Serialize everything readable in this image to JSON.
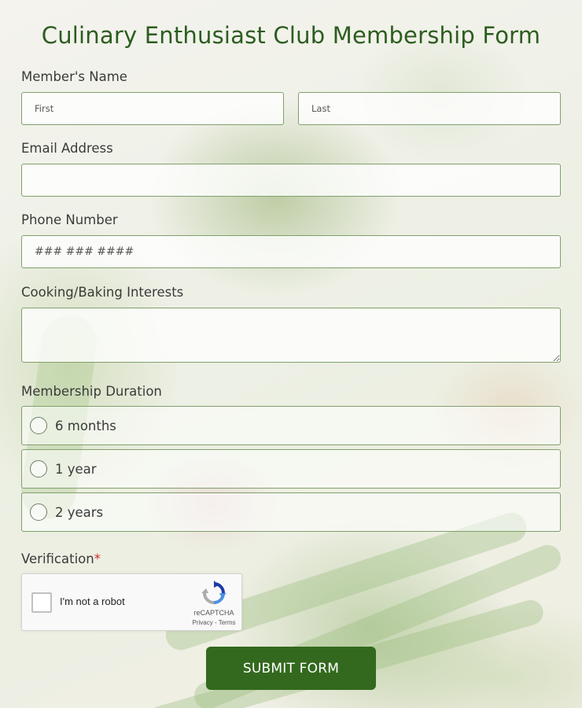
{
  "title": "Culinary Enthusiast Club Membership Form",
  "name": {
    "label": "Member's Name",
    "first_placeholder": "First",
    "last_placeholder": "Last"
  },
  "email": {
    "label": "Email Address",
    "placeholder": ""
  },
  "phone": {
    "label": "Phone Number",
    "placeholder": "### ### ####"
  },
  "interests": {
    "label": "Cooking/Baking Interests"
  },
  "duration": {
    "label": "Membership Duration",
    "options": [
      "6 months",
      "1 year",
      "2 years"
    ]
  },
  "verification": {
    "label": "Verification",
    "required_mark": "*",
    "checkbox_text": "I'm not a robot",
    "brand": "reCAPTCHA",
    "links": "Privacy - Terms"
  },
  "submit_label": "SUBMIT FORM",
  "colors": {
    "accent": "#33691e",
    "title": "#2c5d1f",
    "border": "#7fa06b"
  }
}
